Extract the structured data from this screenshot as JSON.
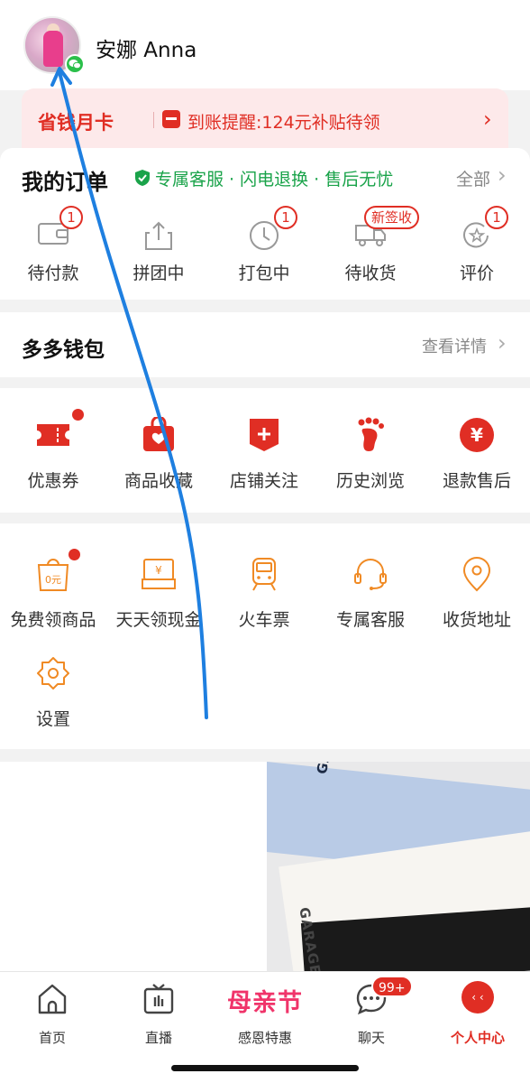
{
  "header": {
    "username": "安娜 Anna",
    "avatar_icon": "user-avatar",
    "badge_icon": "wechat-icon"
  },
  "promo": {
    "title": "省钱月卡",
    "text": "到账提醒:124元补贴待领",
    "arrow": "›"
  },
  "orders": {
    "title": "我的订单",
    "guarantee": "专属客服 · 闪电退换 · 售后无忧",
    "all": "全部",
    "arrow": "›",
    "items": [
      {
        "label": "待付款",
        "badge": "1",
        "icon": "wallet-icon"
      },
      {
        "label": "拼团中",
        "badge": "",
        "icon": "share-icon"
      },
      {
        "label": "打包中",
        "badge": "1",
        "icon": "clock-icon"
      },
      {
        "label": "待收货",
        "badge": "新签收",
        "icon": "truck-icon"
      },
      {
        "label": "评价",
        "badge": "1",
        "icon": "review-icon"
      }
    ]
  },
  "wallet": {
    "title": "多多钱包",
    "detail": "查看详情",
    "arrow": "›"
  },
  "quick": [
    {
      "label": "优惠券",
      "icon": "coupon-icon",
      "dot": true
    },
    {
      "label": "商品收藏",
      "icon": "favorite-bag-icon",
      "dot": false
    },
    {
      "label": "店铺关注",
      "icon": "store-follow-icon",
      "dot": false
    },
    {
      "label": "历史浏览",
      "icon": "footprint-icon",
      "dot": false
    },
    {
      "label": "退款售后",
      "icon": "refund-icon",
      "dot": false
    }
  ],
  "tools": [
    {
      "label": "免费领商品",
      "icon": "free-goods-icon",
      "dot": true,
      "icon_text": "0元"
    },
    {
      "label": "天天领现金",
      "icon": "cash-icon",
      "dot": false,
      "icon_text": "¥"
    },
    {
      "label": "火车票",
      "icon": "train-icon",
      "dot": false
    },
    {
      "label": "专属客服",
      "icon": "headset-icon",
      "dot": false
    },
    {
      "label": "收货地址",
      "icon": "location-icon",
      "dot": false
    },
    {
      "label": "设置",
      "icon": "settings-icon",
      "dot": false
    }
  ],
  "feed": {
    "brand_1": "GARAGE",
    "brand_2": "GARAGE"
  },
  "tabbar": {
    "items": [
      {
        "label": "首页",
        "icon": "home-icon"
      },
      {
        "label": "直播",
        "icon": "tv-icon"
      },
      {
        "label": "感恩特惠",
        "festival": "母亲节"
      },
      {
        "label": "聊天",
        "icon": "chat-icon",
        "badge": "99+"
      },
      {
        "label": "个人中心",
        "icon": "profile-icon",
        "icon_text": "‹ ‹"
      }
    ],
    "active_color": "#e02e24"
  },
  "colors": {
    "accent": "#e02e24",
    "guarantee_green": "#1aa34a",
    "tool_orange": "#f08a24",
    "festival_pink": "#f0346a",
    "annotation_blue": "#1e7fe0"
  }
}
